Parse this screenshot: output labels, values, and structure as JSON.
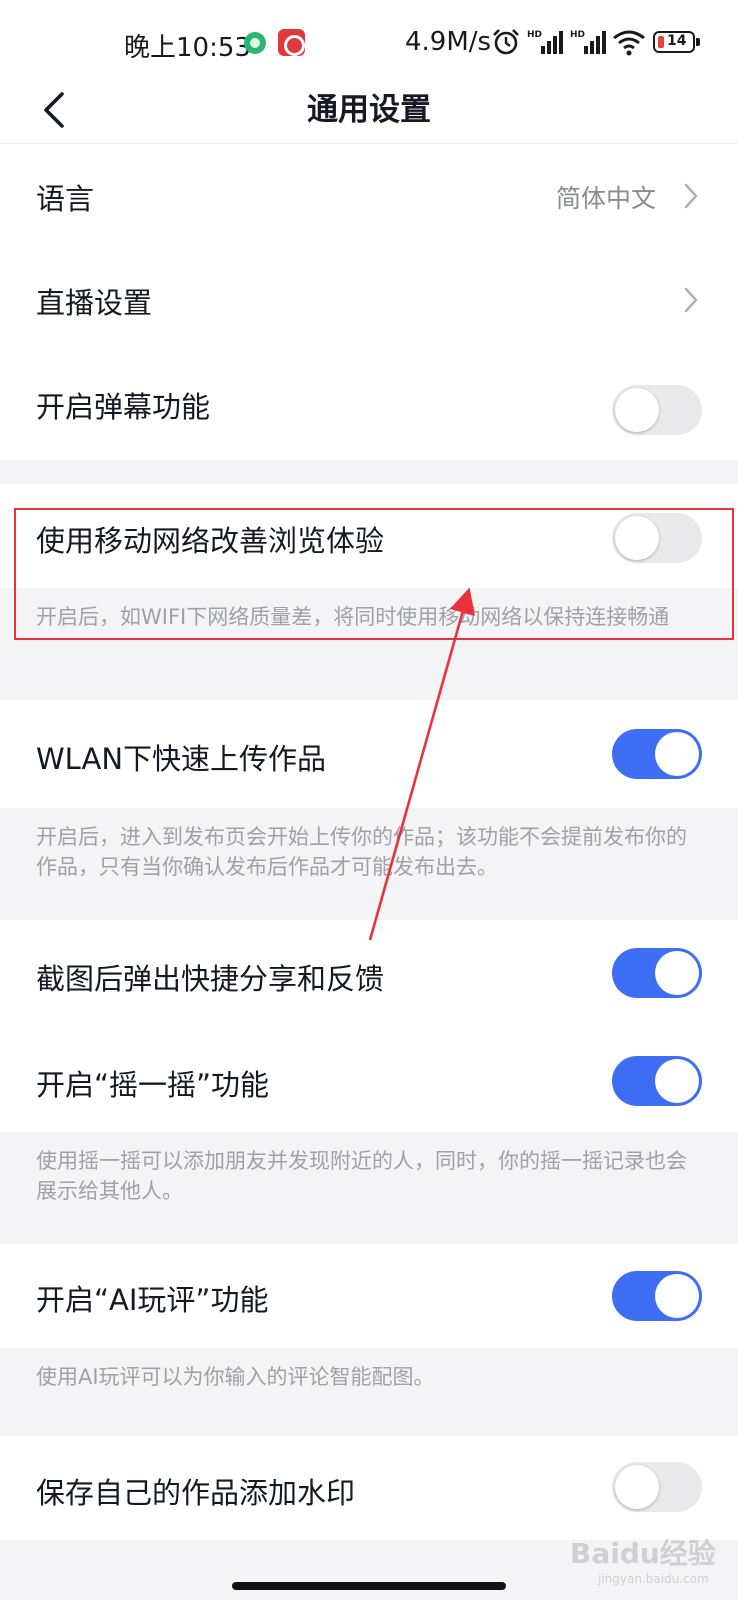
{
  "status_bar": {
    "time": "晚上10:53",
    "network_speed": "4.9M/s",
    "battery": "14",
    "icons": [
      "app-notification-icon",
      "app-notification-icon",
      "alarm-icon",
      "hd-signal-icon",
      "hd-signal-icon",
      "wifi-icon",
      "battery-icon"
    ]
  },
  "nav": {
    "title": "通用设置",
    "back_icon": "chevron-left-icon"
  },
  "rows": {
    "language": {
      "label": "语言",
      "value": "简体中文"
    },
    "live": {
      "label": "直播设置"
    },
    "danmaku": {
      "label": "开启弹幕功能",
      "on": false
    },
    "mobile_network": {
      "label": "使用移动网络改善浏览体验",
      "on": false,
      "note": "开启后，如WIFI下网络质量差，将同时使用移动网络以保持连接畅通"
    },
    "wlan_upload": {
      "label": "WLAN下快速上传作品",
      "on": true,
      "note": "开启后，进入到发布页会开始上传你的作品；该功能不会提前发布你的作品，只有当你确认发布后作品才可能发布出去。"
    },
    "screenshot_share": {
      "label": "截图后弹出快捷分享和反馈",
      "on": true
    },
    "shake": {
      "label": "开启“摇一摇”功能",
      "on": true,
      "note": "使用摇一摇可以添加朋友并发现附近的人，同时，你的摇一摇记录也会展示给其他人。"
    },
    "ai_comment": {
      "label": "开启“AI玩评”功能",
      "on": true,
      "note": "使用AI玩评可以为你输入的评论智能配图。"
    },
    "watermark": {
      "label": "保存自己的作品添加水印",
      "on": false
    }
  },
  "watermark": {
    "brand": "Baidu经验",
    "domain": "jingyan.baidu.com"
  },
  "colors": {
    "accent": "#3d6ef5",
    "annotation": "#e8333a",
    "toggle_off": "#e9e9ec"
  }
}
